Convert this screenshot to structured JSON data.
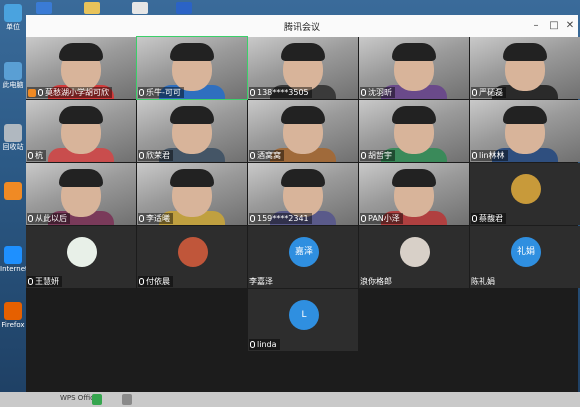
{
  "window": {
    "title": "腾讯会议"
  },
  "desktop": {
    "icons": [
      {
        "label": "单位",
        "color": "#4aa3df"
      },
      {
        "label": "此电脑",
        "color": "#5a9fd4"
      },
      {
        "label": "回收站",
        "color": "#b0b8c0"
      },
      {
        "label": "",
        "color": "#f08a24"
      },
      {
        "label": "Internet Explorer",
        "color": "#1e90ff"
      },
      {
        "label": "Firefox",
        "color": "#e66000"
      }
    ]
  },
  "taskbar": {
    "items": [
      "WPS Office"
    ]
  },
  "participants": [
    {
      "name": "莫愁湖小学胡可欣",
      "kind": "video",
      "host": true,
      "mic": true
    },
    {
      "name": "乐牛-可可",
      "kind": "video",
      "mic": true,
      "active": true
    },
    {
      "name": "138****3505",
      "kind": "video",
      "mic": true
    },
    {
      "name": "沈羽昕",
      "kind": "video",
      "mic": true
    },
    {
      "name": "严砳磊",
      "kind": "video",
      "mic": true
    },
    {
      "name": "杭",
      "kind": "video",
      "mic": true
    },
    {
      "name": "欣荣君",
      "kind": "video",
      "mic": true
    },
    {
      "name": "酒窝窝",
      "kind": "video",
      "mic": true
    },
    {
      "name": "胡哲宇",
      "kind": "video",
      "mic": true
    },
    {
      "name": "lin林林",
      "kind": "video",
      "mic": true
    },
    {
      "name": "从此以后",
      "kind": "video",
      "mic": true
    },
    {
      "name": "李适曦",
      "kind": "video",
      "mic": true
    },
    {
      "name": "159****2341",
      "kind": "video",
      "mic": true
    },
    {
      "name": "PAN小泽",
      "kind": "video",
      "mic": true
    },
    {
      "name": "蔡馥君",
      "kind": "avatar",
      "mic": true,
      "avatar_text": "",
      "avatar_color": "#c89a3a"
    },
    {
      "name": "王慧妍",
      "kind": "avatar",
      "mic": true,
      "avatar_text": "",
      "avatar_color": "#e8f0e8"
    },
    {
      "name": "付依晨",
      "kind": "avatar",
      "mic": true,
      "avatar_text": "",
      "avatar_color": "#c0563a"
    },
    {
      "name": "李嘉泽",
      "kind": "avatar",
      "mic": false,
      "avatar_text": "嘉泽",
      "avatar_color": "#2f8fe0"
    },
    {
      "name": "浪你格郎",
      "kind": "avatar",
      "mic": false,
      "avatar_text": "",
      "avatar_color": "#d8d0c8"
    },
    {
      "name": "陈礼娟",
      "kind": "avatar",
      "mic": false,
      "avatar_text": "礼娟",
      "avatar_color": "#2f8fe0"
    },
    {
      "name": "linda",
      "kind": "avatar",
      "mic": true,
      "avatar_text": "L",
      "avatar_color": "#2f8fe0"
    }
  ]
}
